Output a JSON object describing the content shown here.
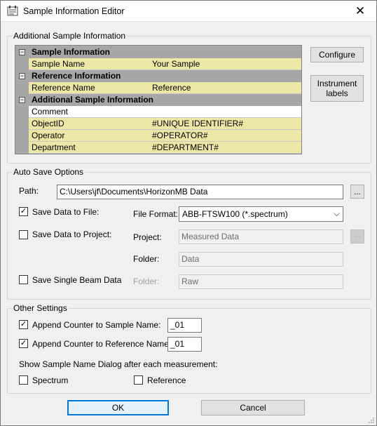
{
  "window": {
    "title": "Sample Information Editor"
  },
  "additional_group": {
    "title": "Additional Sample Information",
    "grid": [
      {
        "kind": "category",
        "label": "Sample Information"
      },
      {
        "kind": "property",
        "name": "Sample Name",
        "value": "Your Sample"
      },
      {
        "kind": "category",
        "label": "Reference Information"
      },
      {
        "kind": "property",
        "name": "Reference Name",
        "value": "Reference"
      },
      {
        "kind": "category",
        "label": "Additional Sample Information"
      },
      {
        "kind": "property",
        "name": "Comment",
        "value": ""
      },
      {
        "kind": "property",
        "name": "ObjectID",
        "value": "#UNIQUE IDENTIFIER#"
      },
      {
        "kind": "property",
        "name": "Operator",
        "value": "#OPERATOR#"
      },
      {
        "kind": "property",
        "name": "Department",
        "value": "#DEPARTMENT#"
      }
    ],
    "toggle_symbol": "−",
    "configure_label": "Configure",
    "instrument_labels_label": "Instrument labels"
  },
  "autosave": {
    "title": "Auto Save Options",
    "path_label": "Path:",
    "path_value": "C:\\Users\\jf\\Documents\\HorizonMB Data",
    "browse_label": "...",
    "save_file_label": "Save Data to File:",
    "save_file_checked": true,
    "file_format_label": "File Format:",
    "file_format_value": "ABB-FTSW100 (*.spectrum)",
    "save_project_label": "Save Data to Project:",
    "save_project_checked": false,
    "project_label": "Project:",
    "project_value": "Measured Data",
    "folder_label": "Folder:",
    "folder_value": "Data",
    "save_single_label": "Save Single Beam Data",
    "save_single_checked": false,
    "single_folder_label": "Folder:",
    "single_folder_value": "Raw"
  },
  "other": {
    "title": "Other Settings",
    "append_sample_label": "Append Counter to Sample Name:",
    "append_sample_checked": true,
    "append_sample_value": "_01",
    "append_reference_label": "Append Counter to Reference Name:",
    "append_reference_checked": true,
    "append_reference_value": "_01",
    "show_dialog_label": "Show Sample Name Dialog after each measurement:",
    "spectrum_label": "Spectrum",
    "spectrum_checked": false,
    "reference_label": "Reference",
    "reference_checked": false
  },
  "footer": {
    "ok_label": "OK",
    "cancel_label": "Cancel"
  },
  "icons": {
    "check_mark": "✓",
    "close": "✕",
    "dropdown": "⌵"
  }
}
